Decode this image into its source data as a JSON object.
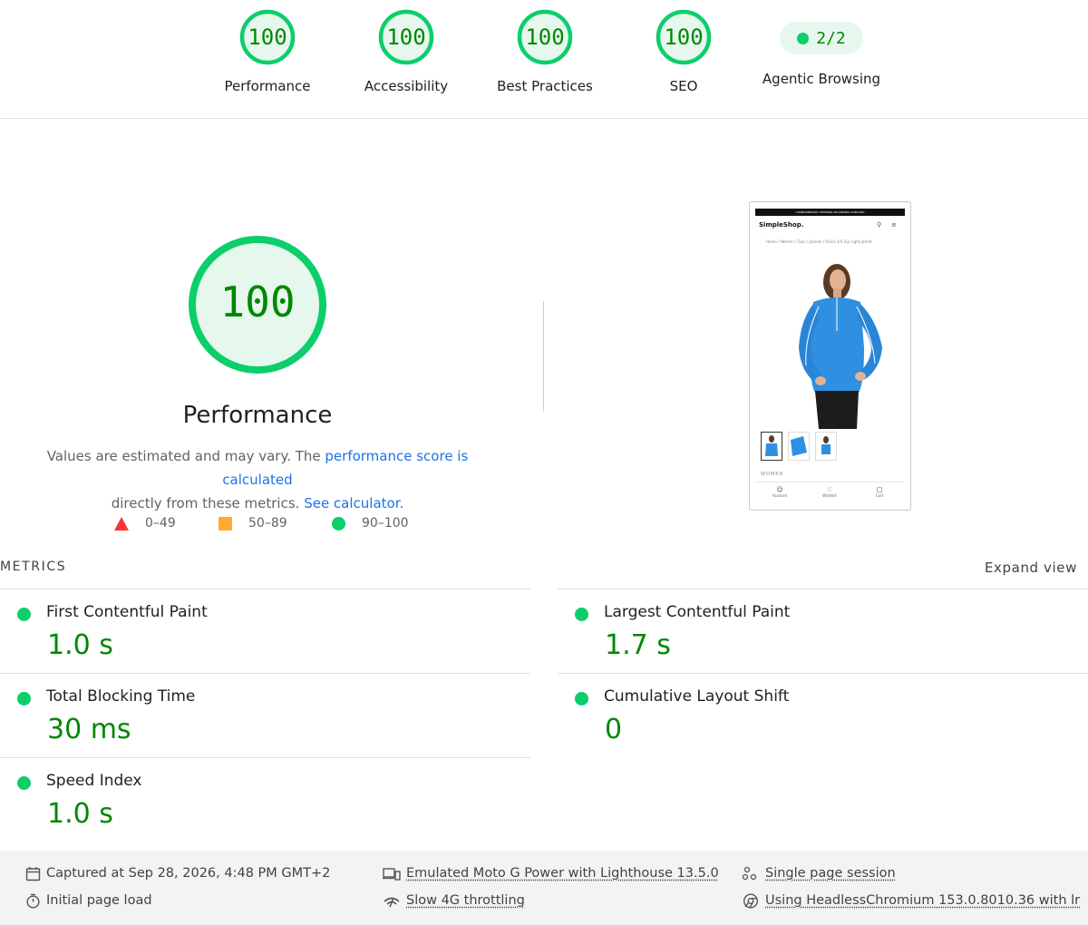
{
  "categories": [
    {
      "label": "Performance",
      "score": "100"
    },
    {
      "label": "Accessibility",
      "score": "100"
    },
    {
      "label": "Best Practices",
      "score": "100"
    },
    {
      "label": "SEO",
      "score": "100"
    }
  ],
  "agentic": {
    "label": "Agentic Browsing",
    "value": "2/2"
  },
  "summary": {
    "score": "100",
    "title": "Performance",
    "desc_prefix": "Values are estimated and may vary. The ",
    "link1": "performance score is calculated",
    "desc_middle": "directly from these metrics. ",
    "link2": "See calculator."
  },
  "legend": {
    "fail": "0–49",
    "average": "50–89",
    "pass": "90–100"
  },
  "colors": {
    "pass": "#0cce6b",
    "pass_text": "#008800",
    "average": "#ffaa33",
    "fail": "#ff3333",
    "link": "#1a73e8"
  },
  "thumbnail": {
    "promo": "COMPLIMENTARY SHIPPING ON ORDERS OVER $50",
    "shop_name": "SimpleShop.",
    "breadcrumb": "Home / Women / Tops / Jackets / Olivia 1/4 Zip Light Jacket",
    "category": "WOMEN",
    "nav": [
      "Account",
      "Wishlist",
      "Cart"
    ]
  },
  "metrics_section": {
    "header": "METRICS",
    "expand": "Expand view"
  },
  "metrics": [
    {
      "title": "First Contentful Paint",
      "value": "1.0 s"
    },
    {
      "title": "Largest Contentful Paint",
      "value": "1.7 s"
    },
    {
      "title": "Total Blocking Time",
      "value": "30 ms"
    },
    {
      "title": "Cumulative Layout Shift",
      "value": "0"
    },
    {
      "title": "Speed Index",
      "value": "1.0 s"
    }
  ],
  "footer": {
    "captured": "Captured at Sep 28, 2026, 4:48 PM GMT+2",
    "initial": "Initial page load",
    "emulated": "Emulated Moto G Power with Lighthouse 13.5.0",
    "throttling": "Slow 4G throttling",
    "session": "Single page session",
    "browser": "Using HeadlessChromium 153.0.8010.36 with lr"
  }
}
